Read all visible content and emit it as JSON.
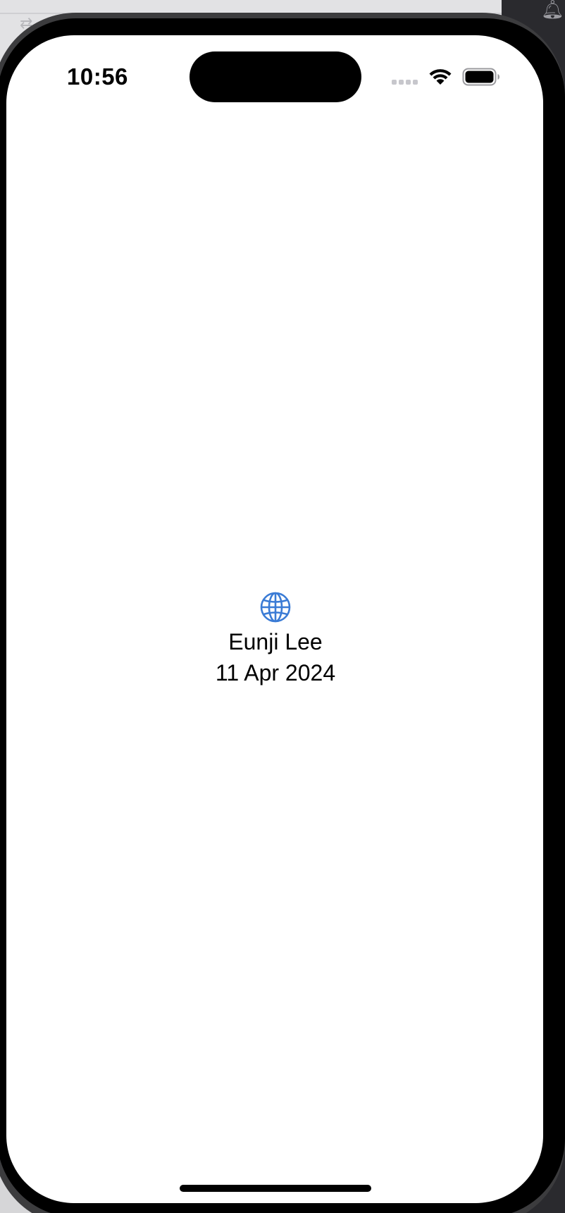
{
  "status_bar": {
    "time": "10:56",
    "wifi_icon": "wifi-icon",
    "battery_icon": "battery-icon",
    "cell_icon": "cellular-signal-icon"
  },
  "main": {
    "icon": "globe-icon",
    "icon_color": "#3a7bd5",
    "name": "Eunji Lee",
    "date": "11 Apr 2024"
  }
}
